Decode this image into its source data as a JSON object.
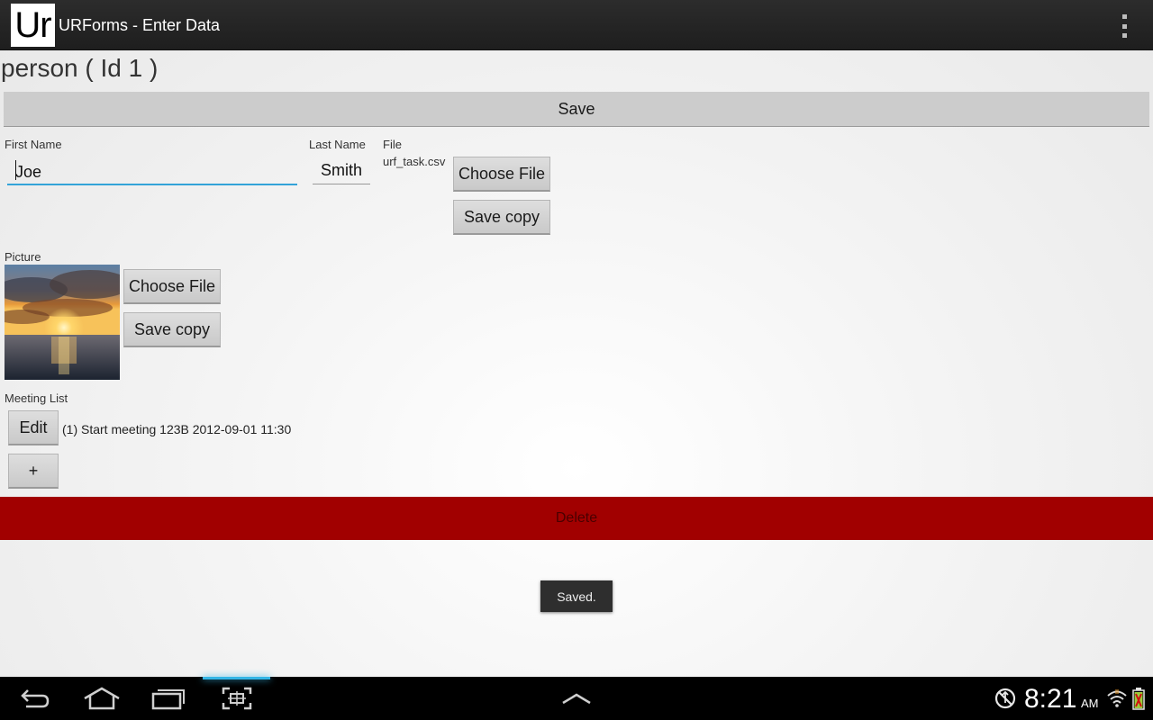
{
  "actionbar": {
    "logo_text": "Ur",
    "title": "URForms - Enter Data"
  },
  "record": {
    "title": "person ( Id 1 )"
  },
  "buttons": {
    "save": "Save",
    "delete": "Delete"
  },
  "fields": {
    "first_name": {
      "label": "First Name",
      "value": "Joe"
    },
    "last_name": {
      "label": "Last Name",
      "value": "Smith"
    },
    "file": {
      "label": "File",
      "filename": "urf_task.csv",
      "choose_label": "Choose File",
      "save_copy_label": "Save copy"
    },
    "picture": {
      "label": "Picture",
      "choose_label": "Choose File",
      "save_copy_label": "Save copy"
    }
  },
  "meeting_list": {
    "label": "Meeting List",
    "edit_label": "Edit",
    "items": [
      "(1) Start meeting 123B 2012-09-01 11:30"
    ],
    "add_label": "+"
  },
  "toast": {
    "text": "Saved."
  },
  "status_bar": {
    "time": "8:21",
    "ampm": "AM"
  },
  "colors": {
    "delete_bar": "#a10000",
    "focus_accent": "#33a3d8",
    "nav_highlight": "#33b5e5"
  }
}
